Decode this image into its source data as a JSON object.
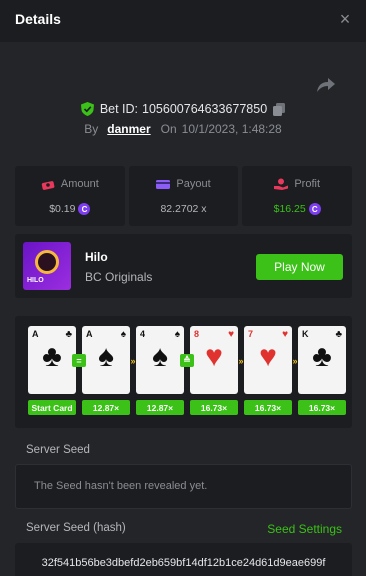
{
  "header": {
    "title": "Details",
    "close_glyph": "×"
  },
  "bet": {
    "id_label": "Bet ID:",
    "id_value": "105600764633677850",
    "by_label": "By",
    "user": "danmer",
    "on_label": "On",
    "datetime": "10/1/2023, 1:48:28"
  },
  "stats": {
    "amount": {
      "label": "Amount",
      "value": "$0.19",
      "icon": "money-icon"
    },
    "payout": {
      "label": "Payout",
      "value": "82.2702 x",
      "icon": "card-icon"
    },
    "profit": {
      "label": "Profit",
      "value": "$16.25",
      "icon": "hand-coin-icon"
    },
    "coin_glyph": "C"
  },
  "game": {
    "name": "Hilo",
    "provider": "BC Originals",
    "play_label": "Play Now",
    "thumb_text": "HILO"
  },
  "cards": [
    {
      "rank": "A",
      "suit": "♣",
      "color": "black",
      "label": "Start Card"
    },
    {
      "rank": "A",
      "suit": "♠",
      "color": "black",
      "label": "12.87×",
      "arrow": "=",
      "arrow_style": "equal"
    },
    {
      "rank": "4",
      "suit": "♠",
      "color": "black",
      "label": "12.87×",
      "arrow": "»",
      "arrow_style": "skip"
    },
    {
      "rank": "8",
      "suit": "♥",
      "color": "red",
      "label": "16.73×",
      "arrow": "≙",
      "arrow_style": "higher"
    },
    {
      "rank": "7",
      "suit": "♥",
      "color": "red",
      "label": "16.73×",
      "arrow": "»",
      "arrow_style": "skip"
    },
    {
      "rank": "K",
      "suit": "♣",
      "color": "black",
      "label": "16.73×",
      "arrow": "»",
      "arrow_style": "skip"
    }
  ],
  "server_seed": {
    "label": "Server Seed",
    "placeholder": "The Seed hasn't been revealed yet."
  },
  "server_seed_hash": {
    "label": "Server Seed (hash)",
    "settings_label": "Seed Settings",
    "value": "32f541b56be3dbefd2eb659bf14df12b1ce24d61d9eae699f"
  },
  "colors": {
    "accent_green": "#3bc117",
    "coin_purple": "#7d3df0",
    "panel": "#1b1d20",
    "background": "#232529"
  }
}
